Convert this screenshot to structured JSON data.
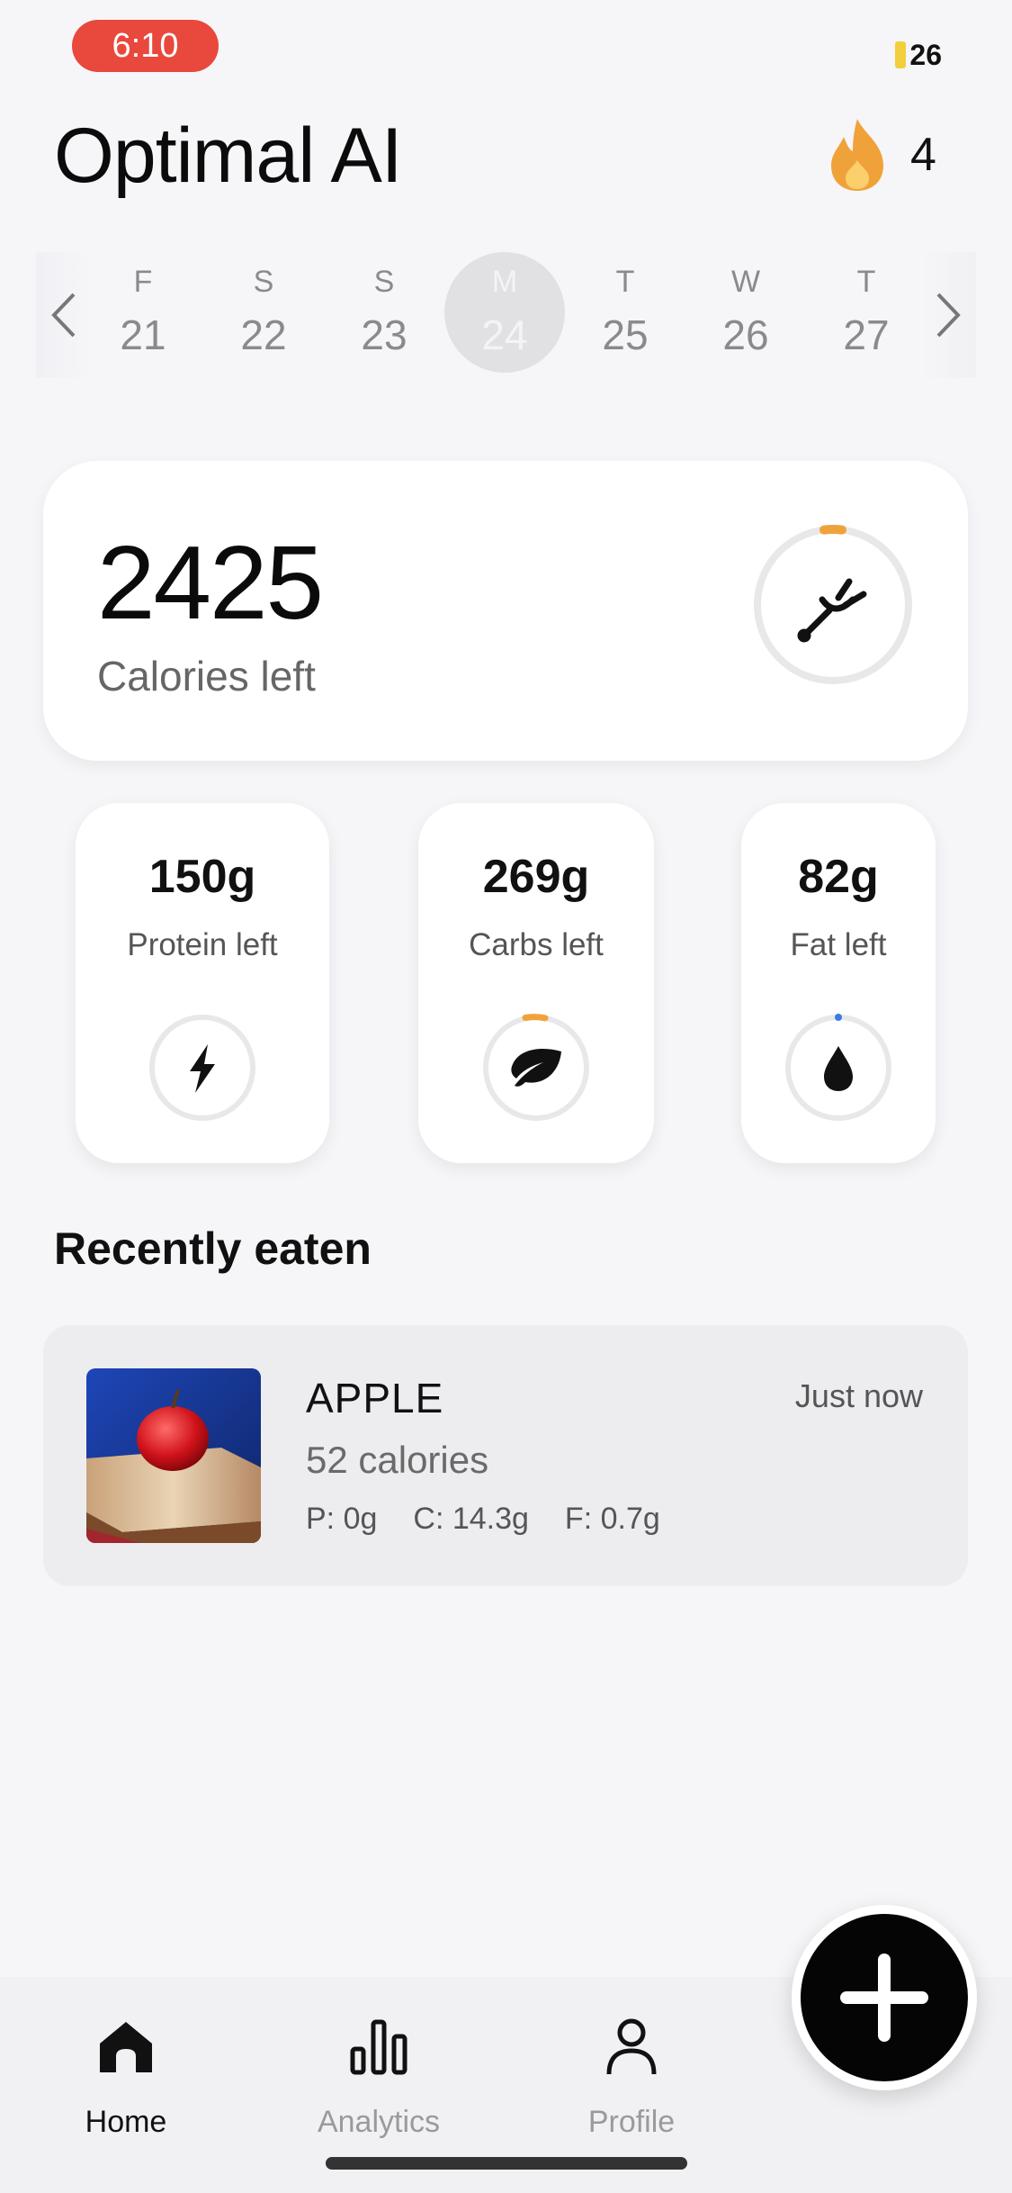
{
  "status_bar": {
    "time": "6:10",
    "battery": "26"
  },
  "header": {
    "title": "Optimal AI",
    "streak_count": "4"
  },
  "date_strip": {
    "days": [
      {
        "dow": "F",
        "date": "21"
      },
      {
        "dow": "S",
        "date": "22"
      },
      {
        "dow": "S",
        "date": "23"
      },
      {
        "dow": "M",
        "date": "24",
        "selected": true
      },
      {
        "dow": "T",
        "date": "25"
      },
      {
        "dow": "W",
        "date": "26"
      },
      {
        "dow": "T",
        "date": "27"
      }
    ]
  },
  "calories": {
    "value": "2425",
    "label": "Calories left"
  },
  "macros": [
    {
      "value": "150g",
      "label": "Protein left",
      "icon": "bolt-icon"
    },
    {
      "value": "269g",
      "label": "Carbs left",
      "icon": "leaf-icon",
      "accent": "#f0a23a"
    },
    {
      "value": "82g",
      "label": "Fat left",
      "icon": "drop-icon",
      "accent": "#3b7be0"
    }
  ],
  "recent": {
    "title": "Recently eaten",
    "items": [
      {
        "name": "APPLE",
        "calories": "52 calories",
        "protein": "P: 0g",
        "carbs": "C: 14.3g",
        "fat": "F: 0.7g",
        "time": "Just now"
      }
    ]
  },
  "nav": {
    "items": [
      {
        "label": "Home",
        "icon": "home-icon",
        "active": true
      },
      {
        "label": "Analytics",
        "icon": "bar-chart-icon"
      },
      {
        "label": "Profile",
        "icon": "person-icon"
      }
    ]
  },
  "colors": {
    "accent_orange": "#f0a23a",
    "accent_blue": "#3b7be0",
    "status_red": "#e8493c"
  }
}
